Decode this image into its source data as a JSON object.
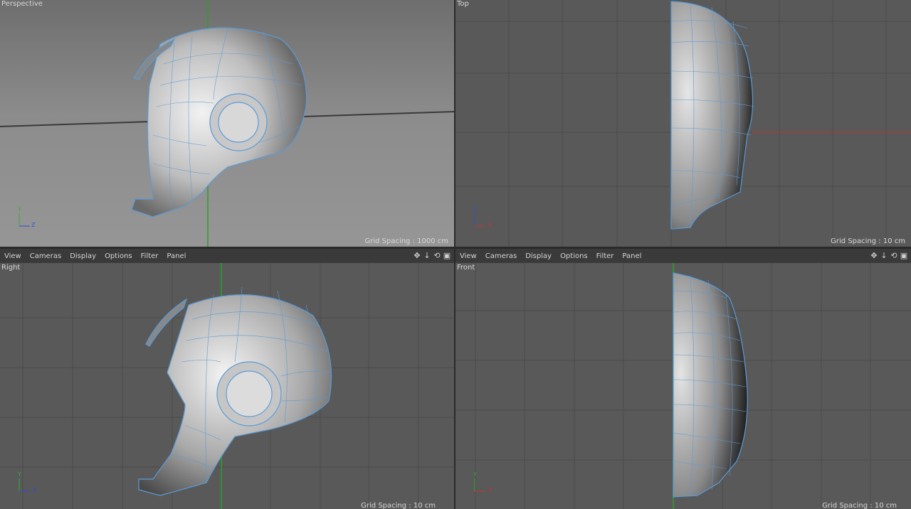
{
  "viewports": {
    "perspective": {
      "title": "Perspective",
      "grid_spacing": "Grid Spacing : 1000 cm"
    },
    "top": {
      "title": "Top",
      "grid_spacing": "Grid Spacing : 10 cm"
    },
    "right": {
      "title": "Right",
      "grid_spacing": "Grid Spacing : 10 cm"
    },
    "front": {
      "title": "Front",
      "grid_spacing": "Grid Spacing : 10 cm"
    }
  },
  "menu": {
    "view": "View",
    "cameras": "Cameras",
    "display": "Display",
    "options": "Options",
    "filter": "Filter",
    "panel": "Panel"
  },
  "axes": {
    "x": "X",
    "y": "Y",
    "z": "Z"
  },
  "colors": {
    "viewport_bg": "#595959",
    "grid_line": "#4a4a4a",
    "wire": "#5b9bd8",
    "x_axis": "#d03030",
    "y_axis": "#30b030",
    "z_axis": "#3050d0"
  }
}
